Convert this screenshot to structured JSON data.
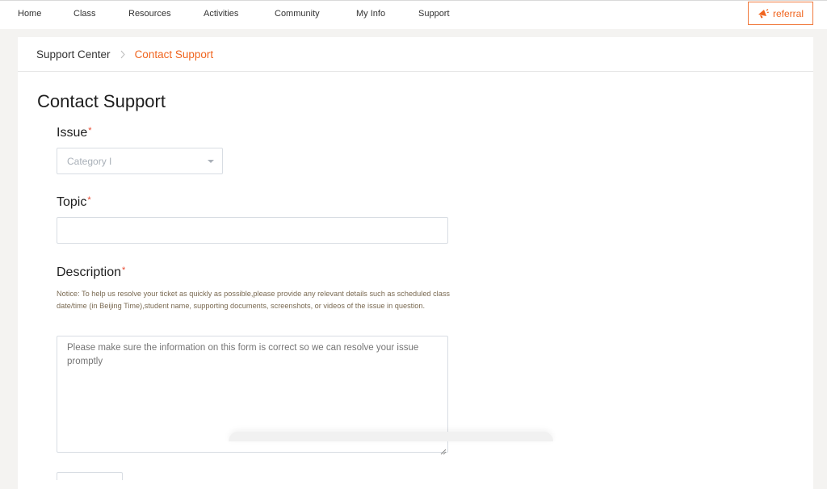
{
  "nav": {
    "items": [
      {
        "label": "Home"
      },
      {
        "label": "Class"
      },
      {
        "label": "Resources"
      },
      {
        "label": "Activities"
      },
      {
        "label": "Community"
      },
      {
        "label": "My Info"
      },
      {
        "label": "Support"
      }
    ],
    "referral_label": "referral",
    "accent_color": "#f0651f"
  },
  "breadcrumb": {
    "parent": "Support Center",
    "current": "Contact Support"
  },
  "page": {
    "title": "Contact Support"
  },
  "form": {
    "issue": {
      "label": "Issue",
      "required_mark": "*",
      "selected_value": "Category I"
    },
    "topic": {
      "label": "Topic",
      "required_mark": "*",
      "value": ""
    },
    "description": {
      "label": "Description",
      "required_mark": "*",
      "notice": "Notice: To help us resolve your ticket as quickly as possible,please provide any relevant details such as scheduled class date/time (in Beijing Time),student name, supporting documents, screenshots, or videos of the issue in question.",
      "placeholder": "Please make sure the information on this form is correct so we can resolve your issue promptly",
      "value": ""
    }
  }
}
